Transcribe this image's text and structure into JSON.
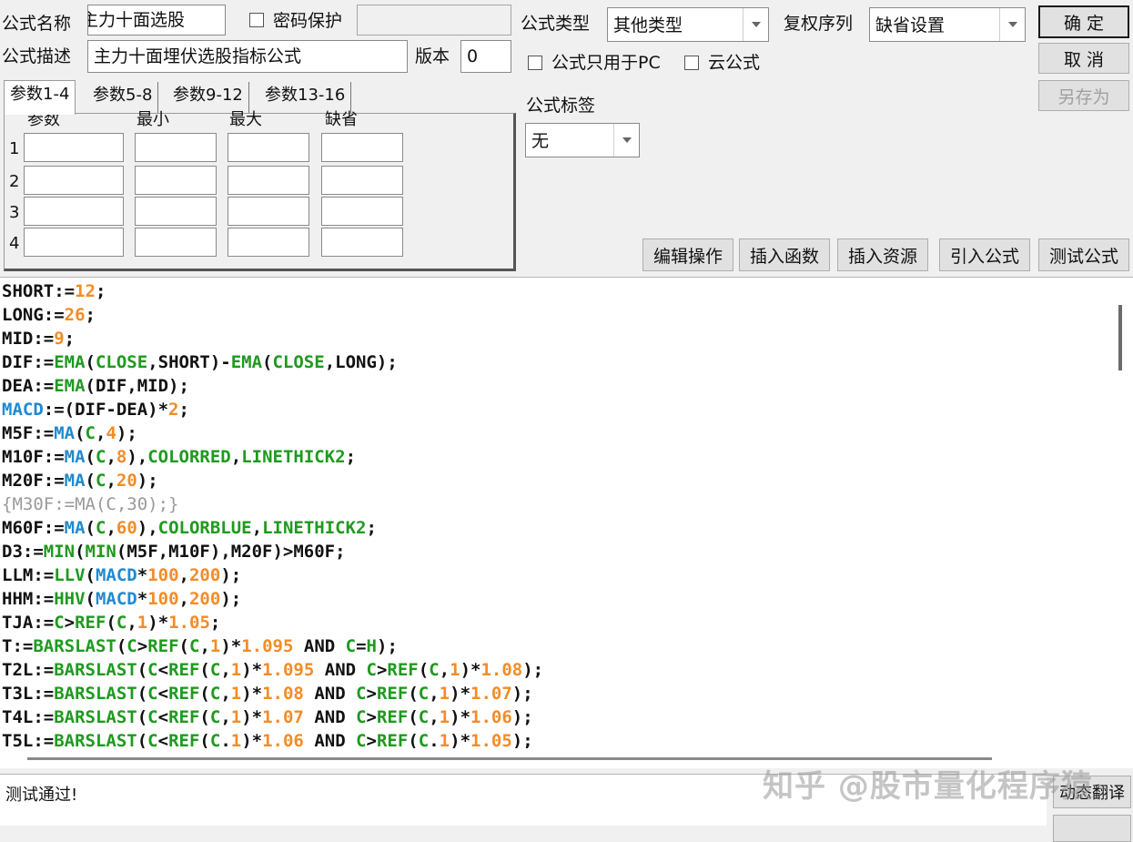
{
  "header": {
    "name_label": "公式名称",
    "name_value": "主力十面选股",
    "password_label": "密码保护",
    "desc_label": "公式描述",
    "desc_value": "主力十面埋伏选股指标公式",
    "version_label": "版本",
    "version_value": "0",
    "type_label": "公式类型",
    "type_value": "其他类型",
    "rights_label": "复权序列",
    "rights_value": "缺省设置",
    "pc_only_label": "公式只用于PC",
    "cloud_label": "云公式",
    "tag_label": "公式标签",
    "tag_value": "无"
  },
  "buttons": {
    "ok": "确 定",
    "cancel": "取 消",
    "save_as": "另存为",
    "edit_ops": "编辑操作",
    "insert_func": "插入函数",
    "insert_res": "插入资源",
    "import_formula": "引入公式",
    "test_formula": "测试公式",
    "dynamic_translate": "动态翻译"
  },
  "params": {
    "tabs": [
      "参数1-4",
      "参数5-8",
      "参数9-12",
      "参数13-16"
    ],
    "columns": [
      "参数",
      "最小",
      "最大",
      "缺省"
    ],
    "rows": [
      "1",
      "2",
      "3",
      "4"
    ]
  },
  "code_lines": [
    [
      [
        "SHORT:=",
        ""
      ],
      [
        "12",
        "num"
      ],
      [
        ";",
        ""
      ]
    ],
    [
      [
        "LONG:=",
        ""
      ],
      [
        "26",
        "num"
      ],
      [
        ";",
        ""
      ]
    ],
    [
      [
        "MID:=",
        ""
      ],
      [
        "9",
        "num"
      ],
      [
        ";",
        ""
      ]
    ],
    [
      [
        "DIF:=",
        ""
      ],
      [
        "EMA",
        "green"
      ],
      [
        "(",
        ""
      ],
      [
        "CLOSE",
        "green"
      ],
      [
        ",SHORT)-",
        ""
      ],
      [
        "EMA",
        "green"
      ],
      [
        "(",
        ""
      ],
      [
        "CLOSE",
        "green"
      ],
      [
        ",LONG);",
        ""
      ]
    ],
    [
      [
        "DEA:=",
        ""
      ],
      [
        "EMA",
        "green"
      ],
      [
        "(DIF,MID);",
        ""
      ]
    ],
    [
      [
        "MACD",
        "blue"
      ],
      [
        ":=(DIF-DEA)*",
        ""
      ],
      [
        "2",
        "num"
      ],
      [
        ";",
        ""
      ]
    ],
    [
      [
        "M5F:=",
        ""
      ],
      [
        "MA",
        "blue"
      ],
      [
        "(",
        ""
      ],
      [
        "C",
        "green"
      ],
      [
        ",",
        ""
      ],
      [
        "4",
        "num"
      ],
      [
        ");",
        ""
      ]
    ],
    [
      [
        "M10F:=",
        ""
      ],
      [
        "MA",
        "blue"
      ],
      [
        "(",
        ""
      ],
      [
        "C",
        "green"
      ],
      [
        ",",
        ""
      ],
      [
        "8",
        "num"
      ],
      [
        "),",
        ""
      ],
      [
        "COLORRED",
        "green"
      ],
      [
        ",",
        ""
      ],
      [
        "LINETHICK2",
        "green"
      ],
      [
        ";",
        ""
      ]
    ],
    [
      [
        "M20F:=",
        ""
      ],
      [
        "MA",
        "blue"
      ],
      [
        "(",
        ""
      ],
      [
        "C",
        "green"
      ],
      [
        ",",
        ""
      ],
      [
        "20",
        "num"
      ],
      [
        ");",
        ""
      ]
    ],
    [
      [
        "{M30F:=MA(C,30);}",
        "gray"
      ]
    ],
    [
      [
        "M60F:=",
        ""
      ],
      [
        "MA",
        "blue"
      ],
      [
        "(",
        ""
      ],
      [
        "C",
        "green"
      ],
      [
        ",",
        ""
      ],
      [
        "60",
        "num"
      ],
      [
        "),",
        ""
      ],
      [
        "COLORBLUE",
        "green"
      ],
      [
        ",",
        ""
      ],
      [
        "LINETHICK2",
        "green"
      ],
      [
        ";",
        ""
      ]
    ],
    [
      [
        "D3:=",
        ""
      ],
      [
        "MIN",
        "green"
      ],
      [
        "(",
        ""
      ],
      [
        "MIN",
        "green"
      ],
      [
        "(M5F,M10F),M20F)>M60F;",
        ""
      ]
    ],
    [
      [
        "LLM:=",
        ""
      ],
      [
        "LLV",
        "green"
      ],
      [
        "(",
        ""
      ],
      [
        "MACD",
        "blue"
      ],
      [
        "*",
        ""
      ],
      [
        "100",
        "num"
      ],
      [
        ",",
        ""
      ],
      [
        "200",
        "num"
      ],
      [
        ");",
        ""
      ]
    ],
    [
      [
        "HHM:=",
        ""
      ],
      [
        "HHV",
        "green"
      ],
      [
        "(",
        ""
      ],
      [
        "MACD",
        "blue"
      ],
      [
        "*",
        ""
      ],
      [
        "100",
        "num"
      ],
      [
        ",",
        ""
      ],
      [
        "200",
        "num"
      ],
      [
        ");",
        ""
      ]
    ],
    [
      [
        "TJA:=",
        ""
      ],
      [
        "C",
        "green"
      ],
      [
        ">",
        ""
      ],
      [
        "REF",
        "green"
      ],
      [
        "(",
        ""
      ],
      [
        "C",
        "green"
      ],
      [
        ",",
        ""
      ],
      [
        "1",
        "num"
      ],
      [
        ")*",
        ""
      ],
      [
        "1.05",
        "num"
      ],
      [
        ";",
        ""
      ]
    ],
    [
      [
        "T:=",
        ""
      ],
      [
        "BARSLAST",
        "green"
      ],
      [
        "(",
        ""
      ],
      [
        "C",
        "green"
      ],
      [
        ">",
        ""
      ],
      [
        "REF",
        "green"
      ],
      [
        "(",
        ""
      ],
      [
        "C",
        "green"
      ],
      [
        ",",
        ""
      ],
      [
        "1",
        "num"
      ],
      [
        ")*",
        ""
      ],
      [
        "1.095",
        "num"
      ],
      [
        " AND ",
        ""
      ],
      [
        "C",
        "green"
      ],
      [
        "=",
        ""
      ],
      [
        "H",
        "green"
      ],
      [
        ");",
        ""
      ]
    ],
    [
      [
        "T2L:=",
        ""
      ],
      [
        "BARSLAST",
        "green"
      ],
      [
        "(",
        ""
      ],
      [
        "C",
        "green"
      ],
      [
        "<",
        ""
      ],
      [
        "REF",
        "green"
      ],
      [
        "(",
        ""
      ],
      [
        "C",
        "green"
      ],
      [
        ",",
        ""
      ],
      [
        "1",
        "num"
      ],
      [
        ")*",
        ""
      ],
      [
        "1.095",
        "num"
      ],
      [
        " AND ",
        ""
      ],
      [
        "C",
        "green"
      ],
      [
        ">",
        ""
      ],
      [
        "REF",
        "green"
      ],
      [
        "(",
        ""
      ],
      [
        "C",
        "green"
      ],
      [
        ",",
        ""
      ],
      [
        "1",
        "num"
      ],
      [
        ")*",
        ""
      ],
      [
        "1.08",
        "num"
      ],
      [
        ");",
        ""
      ]
    ],
    [
      [
        "T3L:=",
        ""
      ],
      [
        "BARSLAST",
        "green"
      ],
      [
        "(",
        ""
      ],
      [
        "C",
        "green"
      ],
      [
        "<",
        ""
      ],
      [
        "REF",
        "green"
      ],
      [
        "(",
        ""
      ],
      [
        "C",
        "green"
      ],
      [
        ",",
        ""
      ],
      [
        "1",
        "num"
      ],
      [
        ")*",
        ""
      ],
      [
        "1.08",
        "num"
      ],
      [
        " AND ",
        ""
      ],
      [
        "C",
        "green"
      ],
      [
        ">",
        ""
      ],
      [
        "REF",
        "green"
      ],
      [
        "(",
        ""
      ],
      [
        "C",
        "green"
      ],
      [
        ",",
        ""
      ],
      [
        "1",
        "num"
      ],
      [
        ")*",
        ""
      ],
      [
        "1.07",
        "num"
      ],
      [
        ");",
        ""
      ]
    ],
    [
      [
        "T4L:=",
        ""
      ],
      [
        "BARSLAST",
        "green"
      ],
      [
        "(",
        ""
      ],
      [
        "C",
        "green"
      ],
      [
        "<",
        ""
      ],
      [
        "REF",
        "green"
      ],
      [
        "(",
        ""
      ],
      [
        "C",
        "green"
      ],
      [
        ",",
        ""
      ],
      [
        "1",
        "num"
      ],
      [
        ")*",
        ""
      ],
      [
        "1.07",
        "num"
      ],
      [
        " AND ",
        ""
      ],
      [
        "C",
        "green"
      ],
      [
        ">",
        ""
      ],
      [
        "REF",
        "green"
      ],
      [
        "(",
        ""
      ],
      [
        "C",
        "green"
      ],
      [
        ",",
        ""
      ],
      [
        "1",
        "num"
      ],
      [
        ")*",
        ""
      ],
      [
        "1.06",
        "num"
      ],
      [
        ");",
        ""
      ]
    ],
    [
      [
        "T5L:=",
        ""
      ],
      [
        "BARSLAST",
        "green"
      ],
      [
        "(",
        ""
      ],
      [
        "C",
        "green"
      ],
      [
        "<",
        ""
      ],
      [
        "REF",
        "green"
      ],
      [
        "(",
        ""
      ],
      [
        "C",
        "green"
      ],
      [
        ".",
        ""
      ],
      [
        "1",
        "num"
      ],
      [
        ")*",
        ""
      ],
      [
        "1.06",
        "num"
      ],
      [
        " AND ",
        ""
      ],
      [
        "C",
        "green"
      ],
      [
        ">",
        ""
      ],
      [
        "REF",
        "green"
      ],
      [
        "(",
        ""
      ],
      [
        "C",
        "green"
      ],
      [
        ".",
        ""
      ],
      [
        "1",
        "num"
      ],
      [
        ")*",
        ""
      ],
      [
        "1.05",
        "num"
      ],
      [
        ");",
        ""
      ]
    ]
  ],
  "status_text": "测试通过!",
  "watermark": "知乎 @股市量化程序猿"
}
